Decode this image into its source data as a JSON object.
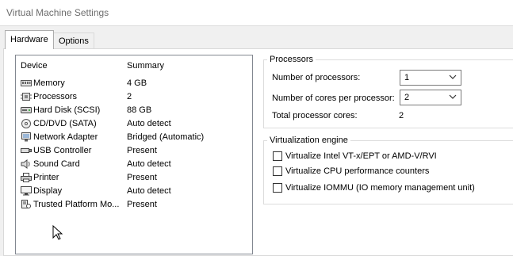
{
  "window": {
    "title": "Virtual Machine Settings"
  },
  "tabs": [
    {
      "label": "Hardware",
      "active": true
    },
    {
      "label": "Options",
      "active": false
    }
  ],
  "device_list": {
    "columns": [
      "Device",
      "Summary"
    ],
    "rows": [
      {
        "icon": "memory-icon",
        "device": "Memory",
        "summary": "4 GB"
      },
      {
        "icon": "processor-icon",
        "device": "Processors",
        "summary": "2"
      },
      {
        "icon": "hard-disk-icon",
        "device": "Hard Disk (SCSI)",
        "summary": "88 GB"
      },
      {
        "icon": "cd-dvd-icon",
        "device": "CD/DVD (SATA)",
        "summary": "Auto detect"
      },
      {
        "icon": "network-adapter-icon",
        "device": "Network Adapter",
        "summary": "Bridged (Automatic)"
      },
      {
        "icon": "usb-controller-icon",
        "device": "USB Controller",
        "summary": "Present"
      },
      {
        "icon": "sound-card-icon",
        "device": "Sound Card",
        "summary": "Auto detect"
      },
      {
        "icon": "printer-icon",
        "device": "Printer",
        "summary": "Present"
      },
      {
        "icon": "display-icon",
        "device": "Display",
        "summary": "Auto detect"
      },
      {
        "icon": "trusted-platform-module-icon",
        "device": "Trusted Platform Mo...",
        "summary": "Present"
      }
    ]
  },
  "processors": {
    "group_label": "Processors",
    "num_processors_label": "Number of processors:",
    "num_processors_value": "1",
    "cores_label": "Number of cores per processor:",
    "cores_value": "2",
    "total_label": "Total processor cores:",
    "total_value": "2"
  },
  "virtualization": {
    "group_label": "Virtualization engine",
    "options": [
      {
        "label": "Virtualize Intel VT-x/EPT or AMD-V/RVI",
        "checked": false
      },
      {
        "label": "Virtualize CPU performance counters",
        "checked": false
      },
      {
        "label": "Virtualize IOMMU (IO memory management unit)",
        "checked": false
      }
    ]
  },
  "colors": {
    "list_border": "#828790",
    "group_border": "#dcdcdc",
    "title_text": "#6d6d6d"
  }
}
